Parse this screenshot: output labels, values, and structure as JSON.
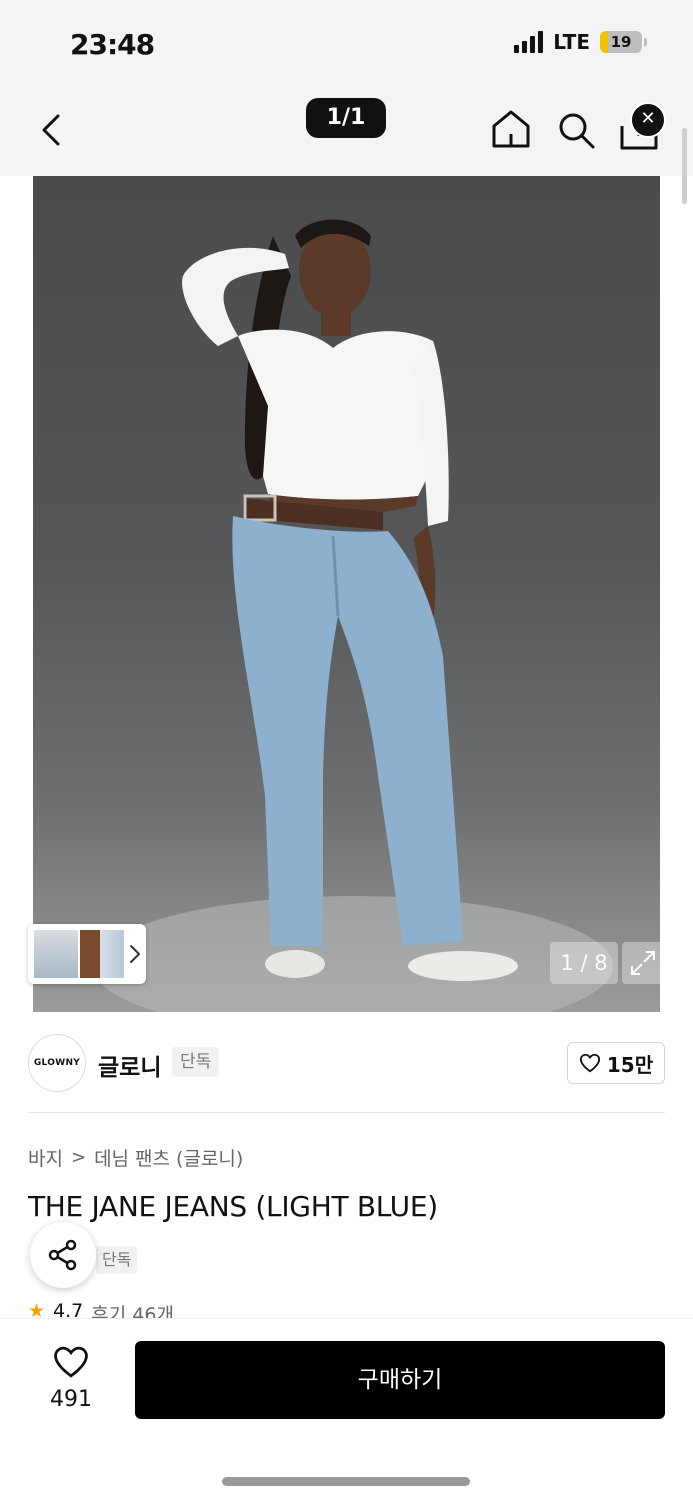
{
  "status_bar": {
    "time": "23:48",
    "network": "LTE",
    "battery": "19"
  },
  "nav": {
    "page_indicator": "1/1"
  },
  "image": {
    "counter": "1 / 8"
  },
  "brand": {
    "logo_text": "GLOWNY",
    "name": "글로니",
    "badge": "단독",
    "likes": "15만"
  },
  "product": {
    "breadcrumb": [
      "바지",
      "데님 팬츠 (글로니)"
    ],
    "title": "THE JANE JEANS (LIGHT BLUE)",
    "exclusive": "단독",
    "rating": "4.7",
    "reviews": "후기 46개"
  },
  "bottom": {
    "wish_count": "491",
    "buy_label": "구매하기"
  },
  "colors": {
    "accent": "#000000",
    "star": "#f5a300"
  },
  "icons": [
    "back-icon",
    "home-icon",
    "search-icon",
    "share-box-icon",
    "close-icon",
    "chevron-right-icon",
    "expand-icon",
    "heart-icon",
    "share-icon",
    "star-icon"
  ]
}
